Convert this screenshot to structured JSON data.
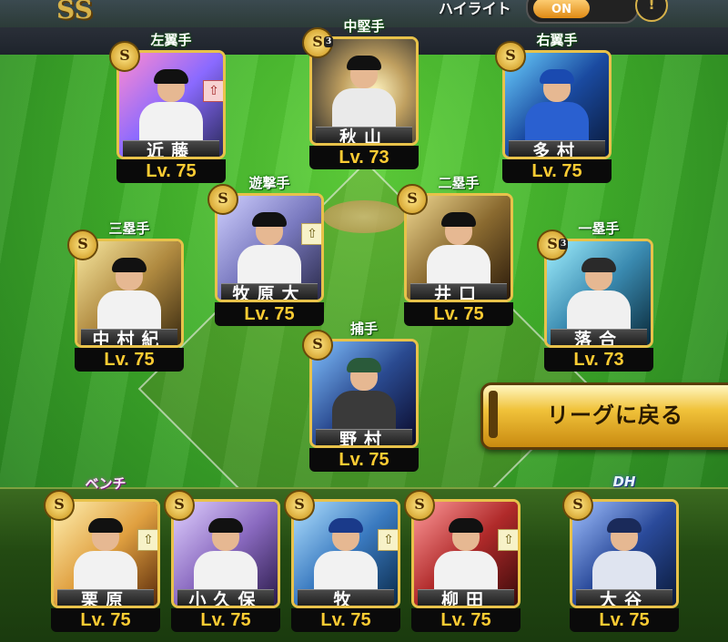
{
  "header": {
    "logo_text": "SS",
    "highlight_label": "ハイライト",
    "toggle_state": "ON",
    "info_symbol": "!"
  },
  "colors": {
    "field_green": "#3fae2a",
    "level_text": "#ffcc33",
    "button_gold": "#f0c23a"
  },
  "positions": {
    "lf": "左翼手",
    "cf": "中堅手",
    "rf": "右翼手",
    "ss": "遊撃手",
    "second": "二塁手",
    "third": "三塁手",
    "first": "一塁手",
    "catcher": "捕手",
    "bench": "ベンチ",
    "dh": "DH"
  },
  "cards": {
    "lf": {
      "name": "近藤",
      "level": "Lv. 75",
      "badge": "S",
      "upgrade_icon": "up-arrow-icon"
    },
    "cf": {
      "name": "秋山",
      "level": "Lv. 73",
      "badge": "S",
      "rank": "3"
    },
    "rf": {
      "name": "多村",
      "level": "Lv. 75",
      "badge": "S"
    },
    "ss": {
      "name": "牧原大",
      "level": "Lv. 75",
      "badge": "S",
      "upgrade_icon": "up-arrow-icon"
    },
    "second": {
      "name": "井口",
      "level": "Lv. 75",
      "badge": "S"
    },
    "third": {
      "name": "中村紀",
      "level": "Lv. 75",
      "badge": "S"
    },
    "first": {
      "name": "落合",
      "level": "Lv. 73",
      "badge": "S",
      "rank": "3"
    },
    "catcher": {
      "name": "野村",
      "level": "Lv. 75",
      "badge": "S"
    },
    "bench1": {
      "name": "栗原",
      "level": "Lv. 75",
      "badge": "S",
      "upgrade_icon": "up-arrow-icon"
    },
    "bench2": {
      "name": "小久保",
      "level": "Lv. 75",
      "badge": "S"
    },
    "bench3": {
      "name": "牧",
      "level": "Lv. 75",
      "badge": "S",
      "upgrade_icon": "up-arrow-icon"
    },
    "bench4": {
      "name": "柳田",
      "level": "Lv. 75",
      "badge": "S",
      "upgrade_icon": "up-arrow-icon"
    },
    "dh": {
      "name": "大谷",
      "level": "Lv. 75",
      "badge": "S"
    }
  },
  "buttons": {
    "back_to_league": "リーグに戻る"
  }
}
